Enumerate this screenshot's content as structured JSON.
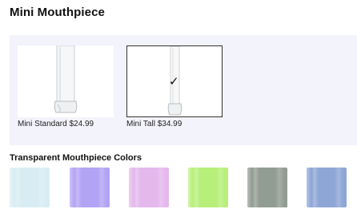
{
  "title": "Mini Mouthpiece",
  "options": [
    {
      "label": "Mini Standard $24.99",
      "selected": false
    },
    {
      "label": "Mini Tall $34.99",
      "selected": true
    }
  ],
  "check_glyph": "✓",
  "colors_heading": "Transparent Mouthpiece Colors",
  "swatches": [
    {
      "color": "#d7edf3"
    },
    {
      "color": "#b3a3f4"
    },
    {
      "color": "#e4b8ec"
    },
    {
      "color": "#b7ef7a"
    },
    {
      "color": "#919c92"
    },
    {
      "color": "#8ea6d5"
    }
  ]
}
